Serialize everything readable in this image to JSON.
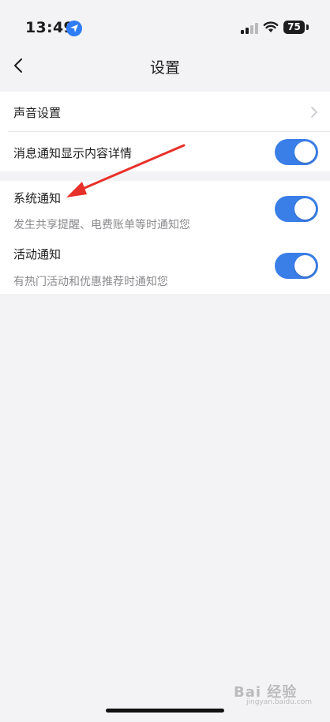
{
  "status_bar": {
    "time": "13:49",
    "battery": "75",
    "icons": [
      "location-icon",
      "signal-icon",
      "wifi-icon",
      "battery-icon"
    ]
  },
  "nav": {
    "title": "设置",
    "back_icon": "chevron-left-icon"
  },
  "group_1": {
    "sound_settings": {
      "label": "声音设置",
      "icon": "chevron-right-icon"
    },
    "message_detail": {
      "label": "消息通知显示内容详情",
      "enabled": true
    }
  },
  "group_2": {
    "system_notice": {
      "label": "系统通知",
      "description": "发生共享提醒、电费账单等时通知您",
      "enabled": true
    },
    "activity_notice": {
      "label": "活动通知",
      "description": "有热门活动和优惠推荐时通知您",
      "enabled": true
    }
  },
  "annotation": {
    "color": "#e8302a",
    "icon": "red-arrow"
  },
  "watermark": {
    "text": "Bai 经验",
    "sub": "jingyan.baidu.com"
  },
  "colors": {
    "accent": "#3a7ee8",
    "background": "#f3f3f6"
  }
}
